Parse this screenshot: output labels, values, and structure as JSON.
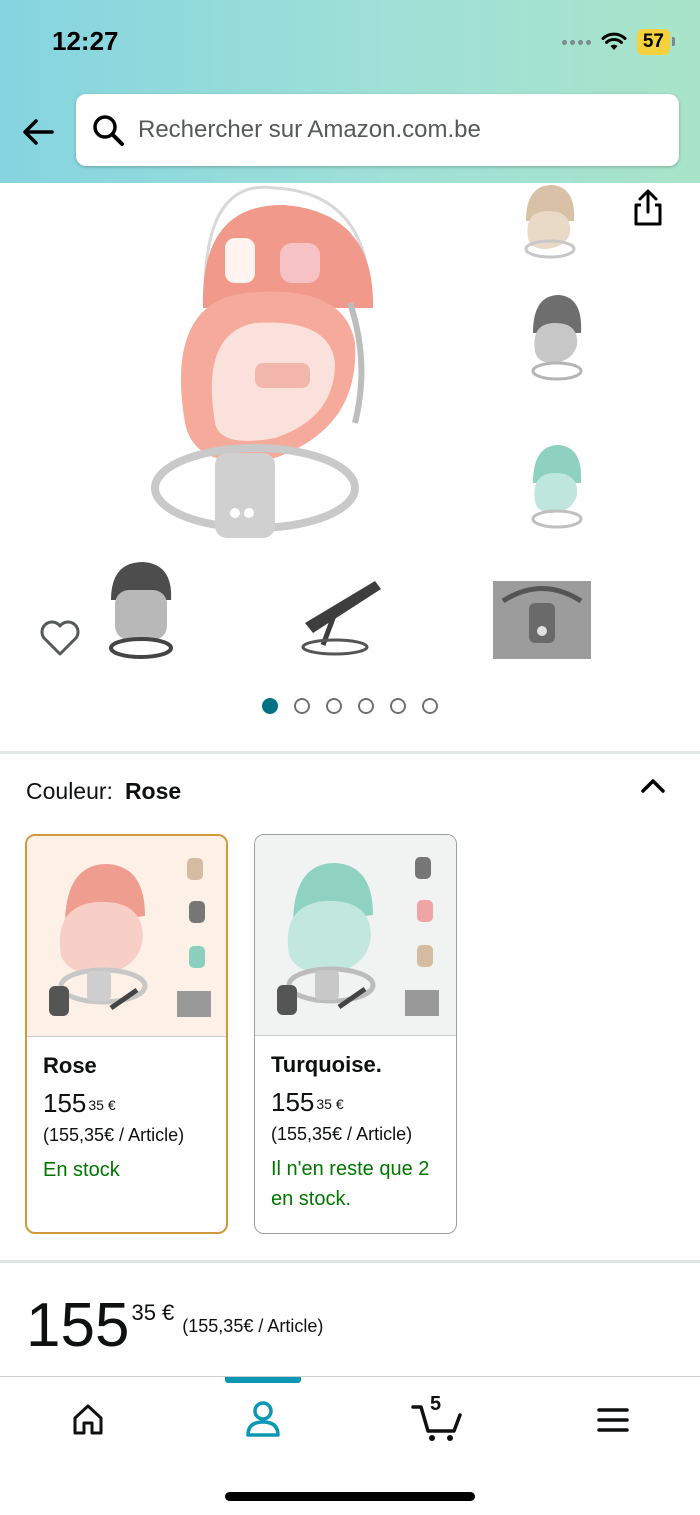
{
  "status_bar": {
    "time": "12:27",
    "battery": "57"
  },
  "search": {
    "placeholder": "Rechercher sur Amazon.com.be"
  },
  "gallery": {
    "page_count": 6,
    "active_page": 1
  },
  "variation": {
    "label": "Couleur:",
    "selected": "Rose"
  },
  "options": [
    {
      "name": "Rose",
      "price_whole": "155",
      "price_fraction": "35",
      "currency": "€",
      "unit_price": "(155,35€ / Article)",
      "stock": "En stock",
      "selected": true
    },
    {
      "name": "Turquoise.",
      "price_whole": "155",
      "price_fraction": "35",
      "currency": "€",
      "unit_price": "(155,35€ / Article)",
      "stock": "Il n'en reste que 2 en stock.",
      "selected": false
    }
  ],
  "price": {
    "whole": "155",
    "fraction_currency": "35 €",
    "unit_price": "(155,35€ / Article)"
  },
  "nav": {
    "cart_count": "5",
    "active_tab": "account"
  },
  "colors": {
    "accent": "#007185",
    "stock_green": "#007600",
    "selected_border": "#d09a3c",
    "nav_indicator": "#0c98b4"
  }
}
